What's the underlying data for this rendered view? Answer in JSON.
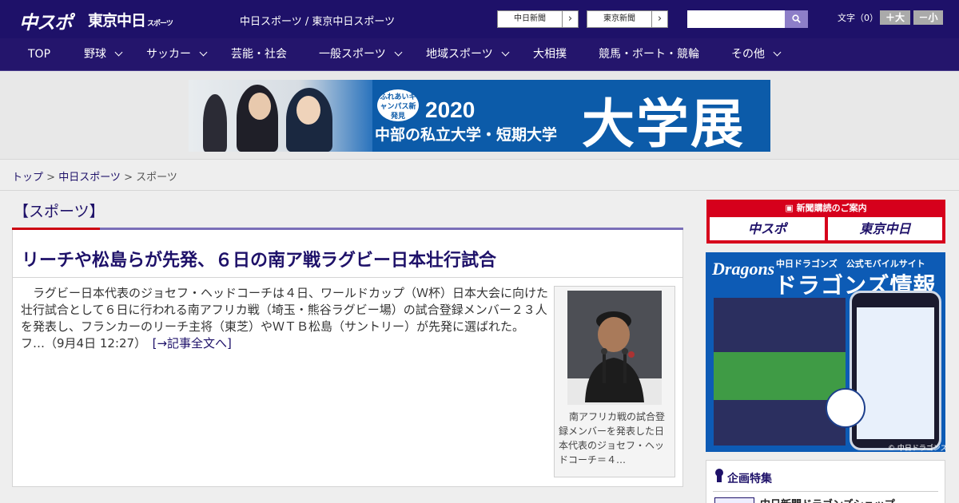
{
  "header": {
    "logo_chuspo": "中スポ",
    "logo_tokyo": "東京中日",
    "logo_tokyo_small": "スポーツ",
    "site_title": "中日スポーツ / 東京中日スポーツ",
    "ext_links": [
      "中日新聞",
      "東京新聞"
    ],
    "search_placeholder": "",
    "font_size_label": "文字（0）",
    "font_larger": "＋大",
    "font_smaller": "－小"
  },
  "nav": {
    "items": [
      {
        "label": "TOP",
        "has_menu": false
      },
      {
        "label": "野球",
        "has_menu": true
      },
      {
        "label": "サッカー",
        "has_menu": true
      },
      {
        "label": "芸能・社会",
        "has_menu": false
      },
      {
        "label": "一般スポーツ",
        "has_menu": true
      },
      {
        "label": "地域スポーツ",
        "has_menu": true
      },
      {
        "label": "大相撲",
        "has_menu": false
      },
      {
        "label": "競馬・ボート・競輪",
        "has_menu": false
      },
      {
        "label": "その他",
        "has_menu": true
      }
    ]
  },
  "banner": {
    "badge": "ふれあいキャンパス新発見",
    "year": "2020",
    "subtitle": "中部の私立大学・短期大学",
    "big_text": "大学展"
  },
  "breadcrumb": {
    "home": "トップ",
    "sep": " > ",
    "section": "中日スポーツ",
    "current": "スポーツ"
  },
  "section": {
    "title": "【スポーツ】"
  },
  "article": {
    "headline": "リーチや松島らが先発、６日の南ア戦ラグビー日本壮行試合",
    "body": "ラグビー日本代表のジョセフ・ヘッドコーチは４日、ワールドカップ（Ｗ杯）日本大会に向けた壮行試合として６日に行われる南アフリカ戦（埼玉・熊谷ラグビー場）の試合登録メンバー２３人を発表し、フランカーのリーチ主将（東芝）やＷＴＢ松島（サントリー）が先発に選ばれた。　フ…（9月4日 12:27）　",
    "more_link": "[→記事全文へ]",
    "caption": "南アフリカ戦の試合登録メンバーを発表した日本代表のジョセフ・ヘッドコーチ＝４…"
  },
  "sidebar": {
    "subscription_title": "新聞購読のご案内",
    "sub_logo_1": "中スポ",
    "sub_logo_2": "東京中日",
    "dragons_logo": "Dragons",
    "dragons_small": "中日ドラゴンズ　公式モバイルサイト",
    "dragons_big": "ドラゴンズ情報",
    "dragons_copy": "© 中日ドラゴンズ",
    "feature_title": "企画特集",
    "feature_item": "中日新聞ドラゴンズショップ"
  },
  "colors": {
    "header_bg": "#1e1169",
    "accent_red": "#cc0011",
    "link": "#1e1169"
  }
}
